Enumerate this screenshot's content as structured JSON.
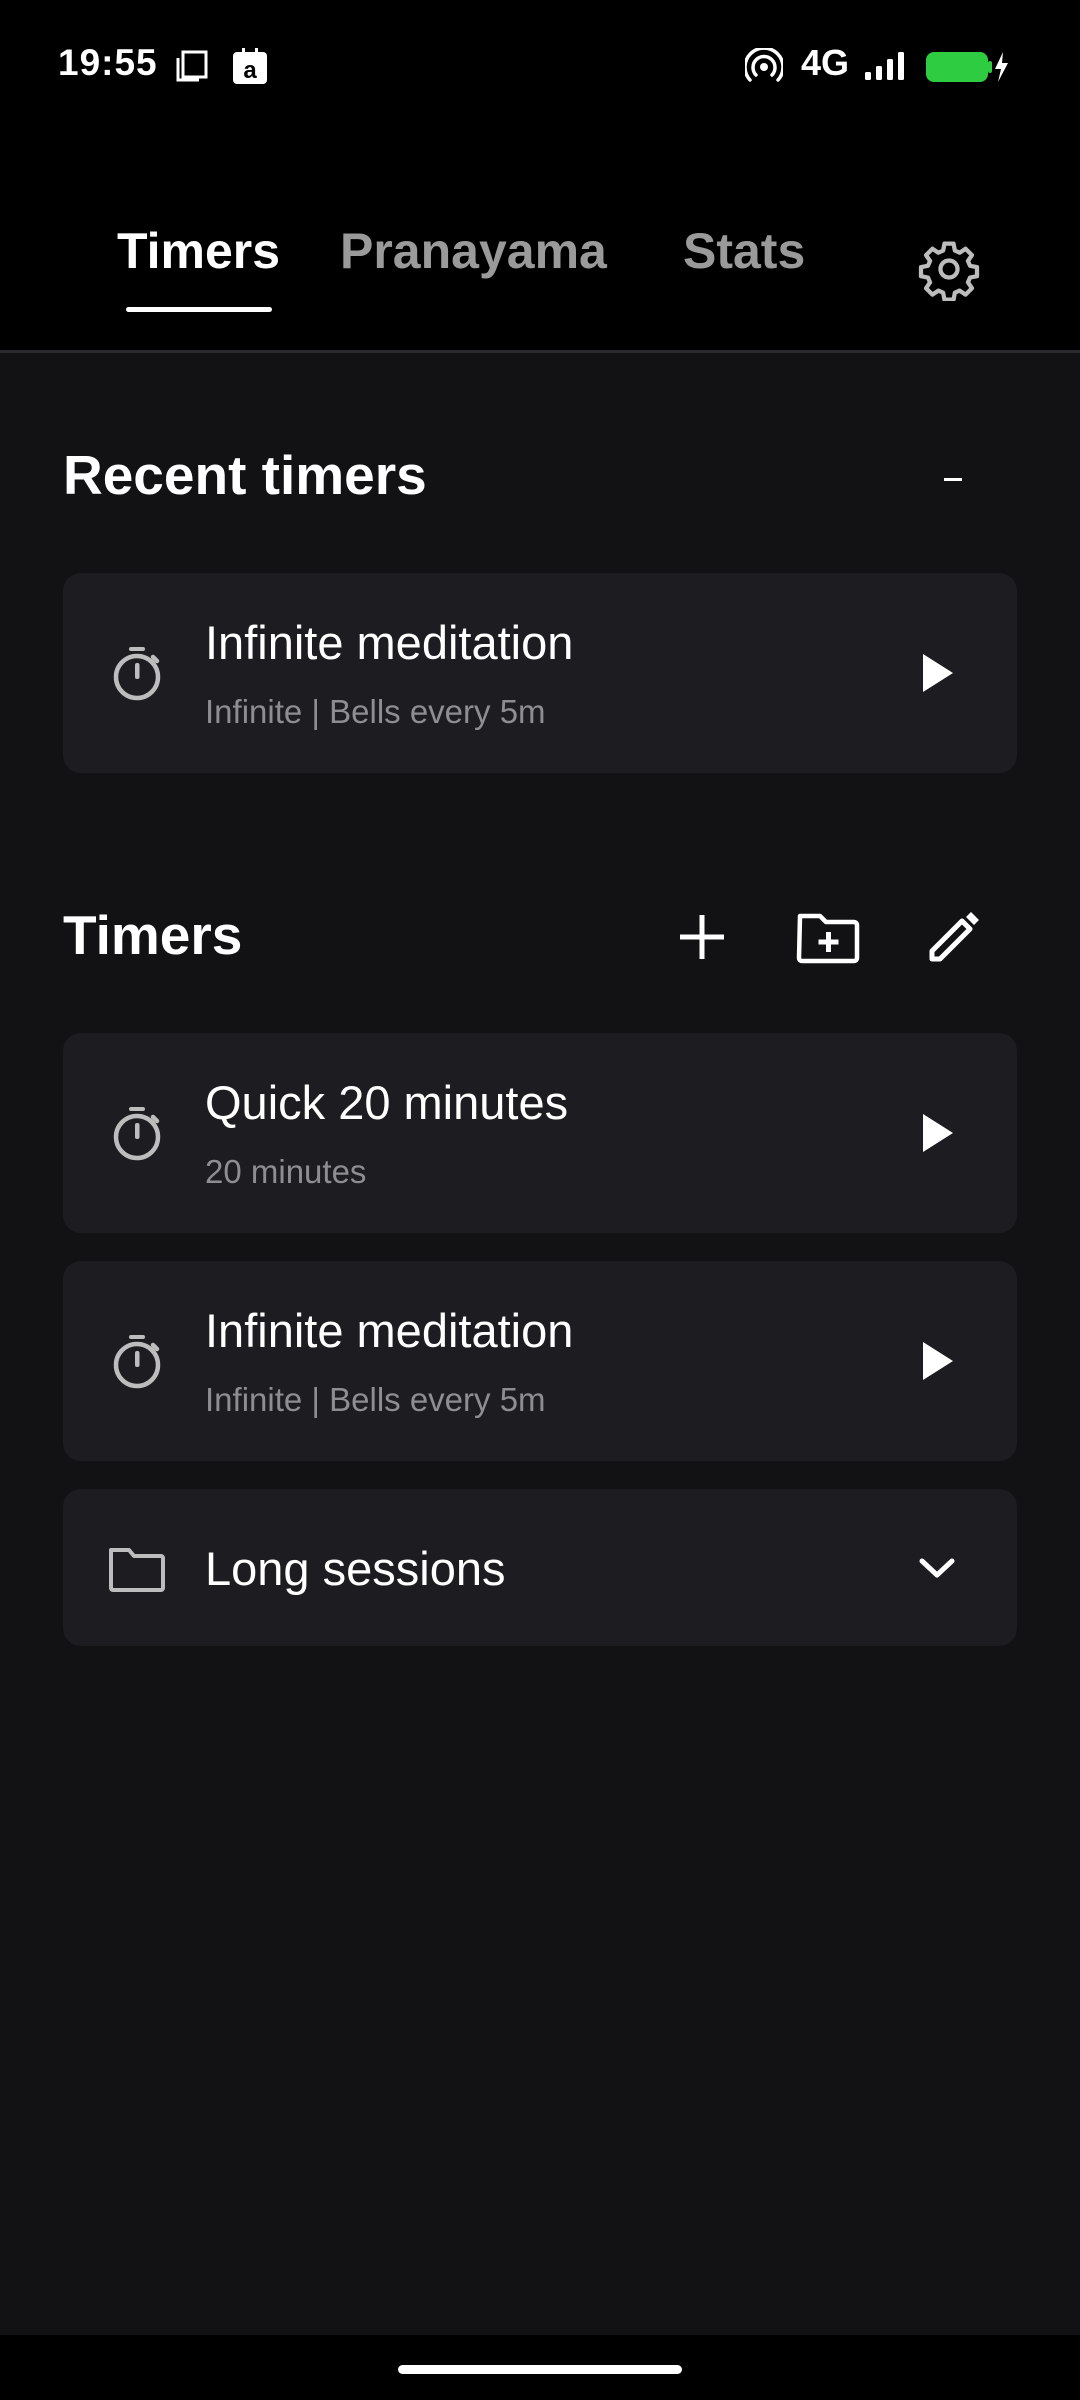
{
  "status_bar": {
    "time": "19:55",
    "network": "4G",
    "battery_color": "#2ecc40"
  },
  "tabs": [
    {
      "label": "Timers",
      "active": true
    },
    {
      "label": "Pranayama",
      "active": false
    },
    {
      "label": "Stats",
      "active": false
    }
  ],
  "recent": {
    "title": "Recent timers",
    "items": [
      {
        "title": "Infinite meditation",
        "subtitle": "Infinite | Bells every 5m",
        "icon": "timer-icon"
      }
    ]
  },
  "timers": {
    "title": "Timers",
    "items": [
      {
        "title": "Quick 20 minutes",
        "subtitle": "20 minutes",
        "icon": "timer-icon"
      },
      {
        "title": "Infinite meditation",
        "subtitle": "Infinite | Bells every 5m",
        "icon": "timer-icon"
      }
    ],
    "folders": [
      {
        "title": "Long sessions",
        "icon": "folder-icon"
      }
    ]
  },
  "colors": {
    "background": "#121214",
    "card": "#1d1d21",
    "header": "#000000",
    "muted_text": "#8d8d92",
    "inactive_tab": "#9a9a9a"
  }
}
